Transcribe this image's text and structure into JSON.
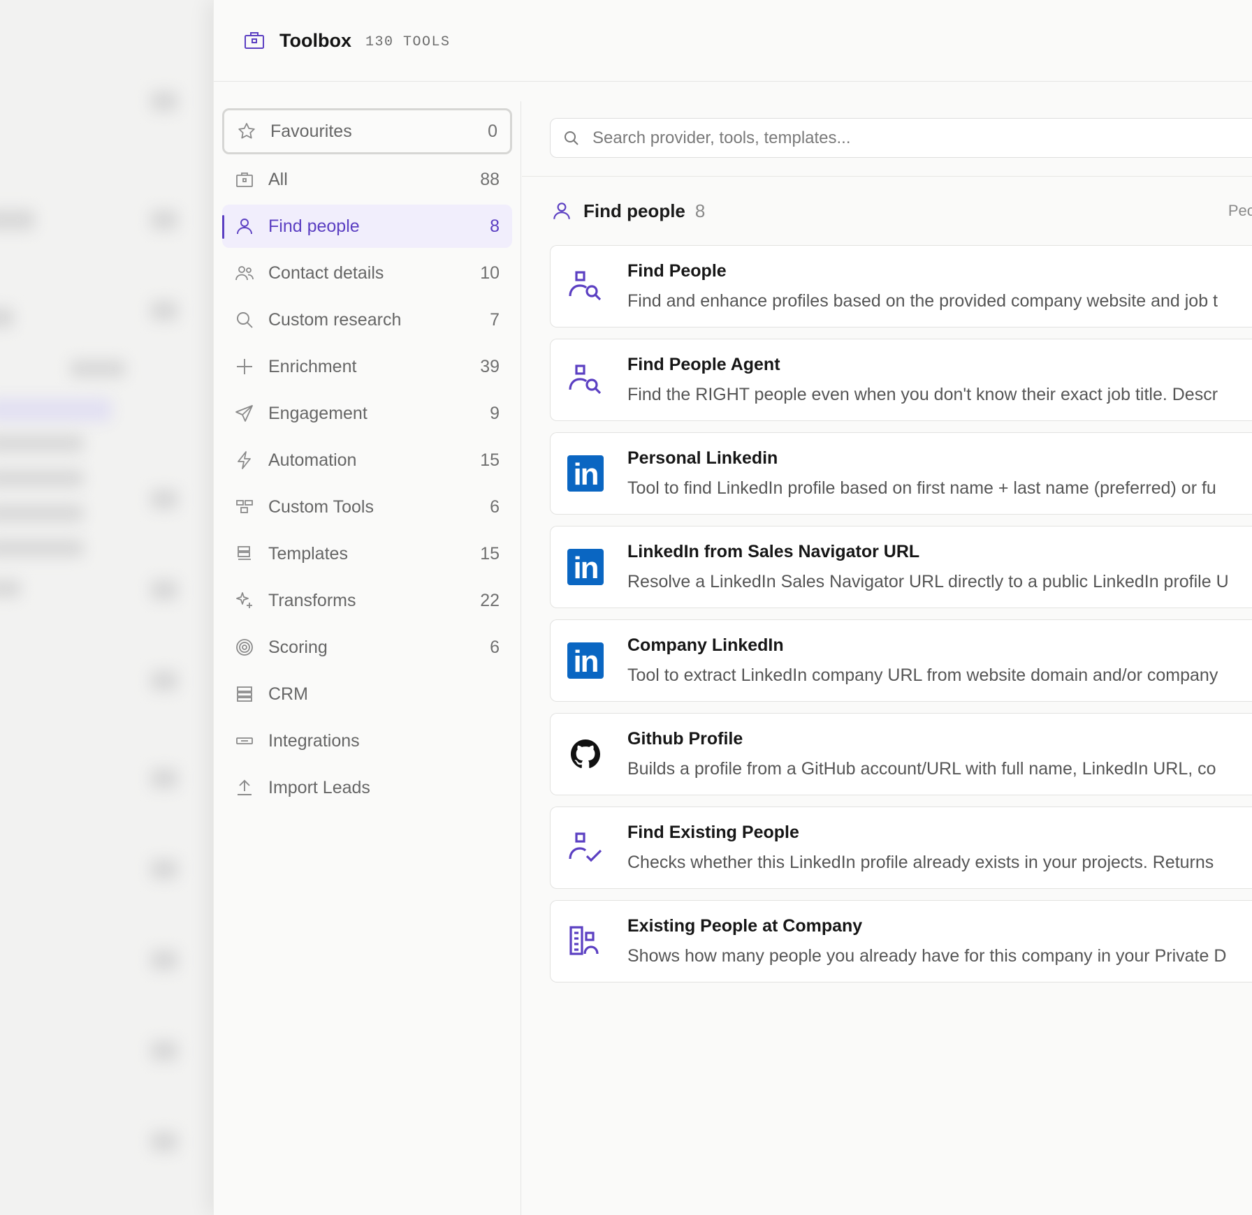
{
  "header": {
    "title": "Toolbox",
    "count_label": "130 TOOLS"
  },
  "sidebar": {
    "items": [
      {
        "label": "Favourites",
        "count": "0",
        "icon": "star-icon"
      },
      {
        "label": "All",
        "count": "88",
        "icon": "toolbox-icon"
      },
      {
        "label": "Find people",
        "count": "8",
        "icon": "user-icon"
      },
      {
        "label": "Contact details",
        "count": "10",
        "icon": "users-icon"
      },
      {
        "label": "Custom research",
        "count": "7",
        "icon": "search-icon"
      },
      {
        "label": "Enrichment",
        "count": "39",
        "icon": "plus-icon"
      },
      {
        "label": "Engagement",
        "count": "9",
        "icon": "send-icon"
      },
      {
        "label": "Automation",
        "count": "15",
        "icon": "bolt-icon"
      },
      {
        "label": "Custom Tools",
        "count": "6",
        "icon": "blocks-icon"
      },
      {
        "label": "Templates",
        "count": "15",
        "icon": "templates-icon"
      },
      {
        "label": "Transforms",
        "count": "22",
        "icon": "sparkle-icon"
      },
      {
        "label": "Scoring",
        "count": "6",
        "icon": "target-icon"
      },
      {
        "label": "CRM",
        "count": "",
        "icon": "database-icon"
      },
      {
        "label": "Integrations",
        "count": "",
        "icon": "plug-icon"
      },
      {
        "label": "Import Leads",
        "count": "",
        "icon": "upload-icon"
      }
    ],
    "active_index": 2
  },
  "search": {
    "placeholder": "Search provider, tools, templates...",
    "value": ""
  },
  "section": {
    "title": "Find people",
    "count": "8",
    "right_label": "Peo"
  },
  "tools": [
    {
      "name": "Find People",
      "description": "Find and enhance profiles based on the provided company website and job t",
      "icon": "find-person-icon"
    },
    {
      "name": "Find People Agent",
      "description": "Find the RIGHT people even when you don't know their exact job title. Descr",
      "icon": "find-person-icon"
    },
    {
      "name": "Personal Linkedin",
      "description": "Tool to find LinkedIn profile based on first name + last name (preferred) or fu",
      "icon": "linkedin-icon"
    },
    {
      "name": "LinkedIn from Sales Navigator URL",
      "description": "Resolve a LinkedIn Sales Navigator URL directly to a public LinkedIn profile U",
      "icon": "linkedin-icon"
    },
    {
      "name": "Company LinkedIn",
      "description": "Tool to extract LinkedIn company URL from website domain and/or company",
      "icon": "linkedin-icon"
    },
    {
      "name": "Github Profile",
      "description": "Builds a profile from a GitHub account/URL with full name, LinkedIn URL, co",
      "icon": "github-icon"
    },
    {
      "name": "Find Existing People",
      "description": "Checks whether this LinkedIn profile already exists in your projects. Returns",
      "icon": "person-check-icon"
    },
    {
      "name": "Existing People at Company",
      "description": "Shows how many people you already have for this company in your Private D",
      "icon": "building-icon"
    }
  ],
  "colors": {
    "accent": "#5b3fc2",
    "linkedin": "#0a66c2",
    "active_bg": "#f1eefc"
  }
}
